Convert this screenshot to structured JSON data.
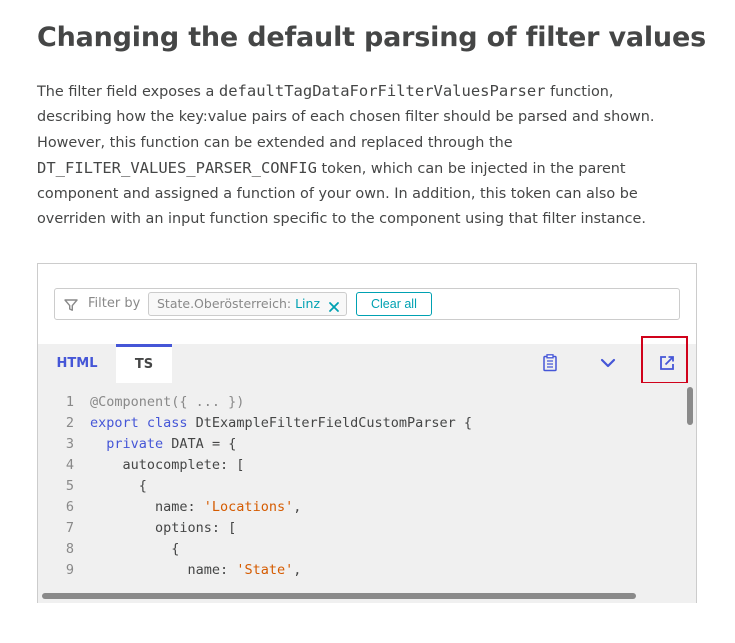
{
  "heading": "Changing the default parsing of filter values",
  "paragraph": {
    "t1": "The filter field exposes a ",
    "code1": "defaultTagDataForFilterValuesParser",
    "t2": " function, describing how the key:value pairs of each chosen filter should be parsed and shown. However, this function can be extended and replaced through the ",
    "code2": "DT_FILTER_VALUES_PARSER_CONFIG",
    "t3": " token, which can be injected in the parent component and assigned a function of your own. In addition, this token can also be overriden with an input function specific to the component using that filter instance."
  },
  "filter": {
    "label": "Filter by",
    "tag_key": "State.Oberösterreich:",
    "tag_value": "Linz",
    "clear_label": "Clear all"
  },
  "tabs": {
    "html": "HTML",
    "ts": "TS"
  },
  "toolbar": {
    "copy_icon": "clipboard-icon",
    "toggle_icon": "chevron-down-icon",
    "open_icon": "external-link-icon"
  },
  "colors": {
    "accent": "#4556d7",
    "tag_value": "#00a1b2",
    "string": "#d55b00",
    "highlight": "#d0021b"
  },
  "code_lines": [
    {
      "num": "1",
      "a": "@Component({ ... })"
    },
    {
      "num": "2",
      "kw": "export class",
      "a": " DtExampleFilterFieldCustomParser {"
    },
    {
      "num": "3",
      "indent": "  ",
      "kw": "private",
      "a": " DATA = {"
    },
    {
      "num": "4",
      "a": "    autocomplete: ["
    },
    {
      "num": "5",
      "a": "      {"
    },
    {
      "num": "6",
      "a": "        name: ",
      "str": "'Locations'",
      "b": ","
    },
    {
      "num": "7",
      "a": "        options: ["
    },
    {
      "num": "8",
      "a": "          {"
    },
    {
      "num": "9",
      "a": "            name: ",
      "str": "'State'",
      "b": ","
    }
  ]
}
